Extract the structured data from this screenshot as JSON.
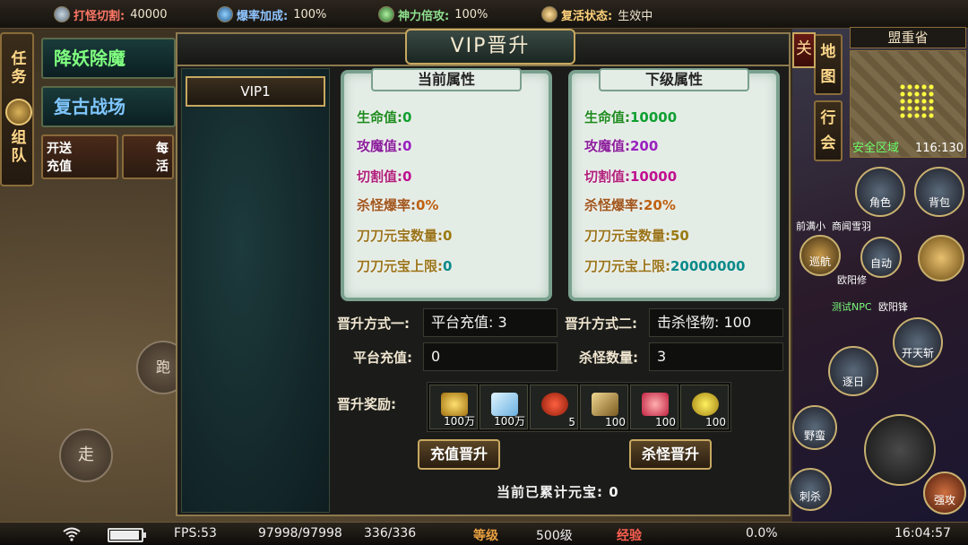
{
  "topbar": {
    "items": [
      {
        "label": "打怪切割:",
        "value": "40000"
      },
      {
        "label": "爆率加成:",
        "value": "100%"
      },
      {
        "label": "神力倍攻:",
        "value": "100%"
      },
      {
        "label": "复活状态:",
        "value": "生效中"
      }
    ]
  },
  "left": {
    "task_tab": "任务",
    "team_tab": "组队",
    "btn_demon": "降妖除魔",
    "btn_battlefield": "复古战场",
    "btn_recharge_line1": "开送",
    "btn_recharge_line2": "充值",
    "btn_activity_line1": "每",
    "btn_activity_line2": "活",
    "walk": "走",
    "road": "跑"
  },
  "right": {
    "map_name": "盟重省",
    "zone": "安全区域",
    "coords": "116:130",
    "map_btn": "地图",
    "guild_btn": "行会",
    "role": "角色",
    "bag": "背包",
    "patrol": "巡航",
    "auto": "自动",
    "names": [
      "前满小",
      "商闻雪羽",
      "欧阳修",
      "测试NPC",
      "欧阳锋"
    ],
    "skill_labels": [
      "开天斩",
      "逐日",
      "野蛮",
      "刺杀",
      "强攻"
    ]
  },
  "dialog": {
    "title": "VIP晋升",
    "close": "关",
    "tab": "VIP1",
    "current": {
      "title": "当前属性",
      "attrs": [
        {
          "k": "生命值:",
          "v": "0"
        },
        {
          "k": "攻魔值:",
          "v": "0"
        },
        {
          "k": "切割值:",
          "v": "0"
        },
        {
          "k": "杀怪爆率:",
          "v": "0%"
        },
        {
          "k": "刀刀元宝数量:",
          "v": "0"
        },
        {
          "k": "刀刀元宝上限:",
          "v": "0"
        }
      ]
    },
    "next": {
      "title": "下级属性",
      "attrs": [
        {
          "k": "生命值:",
          "v": "10000"
        },
        {
          "k": "攻魔值:",
          "v": "200"
        },
        {
          "k": "切割值:",
          "v": "10000"
        },
        {
          "k": "杀怪爆率:",
          "v": "20%"
        },
        {
          "k": "刀刀元宝数量:",
          "v": "50"
        },
        {
          "k": "刀刀元宝上限:",
          "v": "20000000"
        }
      ]
    },
    "method1_label": "晋升方式一:",
    "method1_value": "平台充值: 3",
    "method2_label": "晋升方式二:",
    "method2_value": "击杀怪物: 100",
    "recharge_label": "平台充值:",
    "recharge_value": "0",
    "kills_label": "杀怪数量:",
    "kills_value": "3",
    "reward_label": "晋升奖励:",
    "rewards": [
      {
        "icon": "gold-ingot-icon",
        "amount": "100万"
      },
      {
        "icon": "diamond-icon",
        "amount": "100万"
      },
      {
        "icon": "red-bag-icon",
        "amount": "5"
      },
      {
        "icon": "scroll-icon",
        "amount": "100"
      },
      {
        "icon": "heart-icon",
        "amount": "100"
      },
      {
        "icon": "gold-orb-icon",
        "amount": "100"
      }
    ],
    "btn_recharge": "充值晋升",
    "btn_kill": "杀怪晋升",
    "total_text": "当前已累计元宝: 0"
  },
  "bottombar": {
    "fps": "FPS:53",
    "hp": "97998/97998",
    "mp": "336/336",
    "level_label": "等级",
    "level": "500级",
    "exp_label": "经验",
    "exp": "0.0%",
    "time": "16:04:57",
    "battery_level": 0.95
  }
}
